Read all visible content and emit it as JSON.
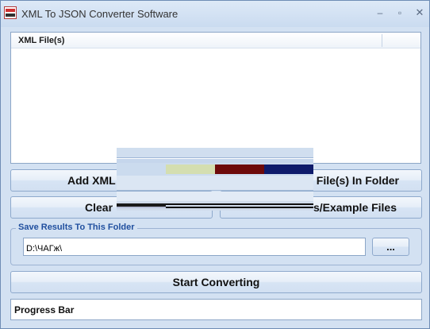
{
  "window": {
    "title": "XML To JSON Converter Software",
    "minimize": "–",
    "maximize": "▫",
    "close": "✕"
  },
  "file_list": {
    "header": "XML File(s)",
    "items": []
  },
  "buttons": {
    "add_files": "Add XML",
    "add_folder": "File(s) In Folder",
    "clear": "Clear",
    "example_files": "s/Example Files",
    "browse": "...",
    "start": "Start Converting"
  },
  "output": {
    "group_title": "Save Results To This Folder",
    "folder_path": "D:\\ЧАГж\\"
  },
  "progress": {
    "label": "Progress Bar"
  },
  "colors": {
    "accent": "#1f4e9e",
    "window_bg": "#d3e1f2",
    "glitch_red": "#6d0a0a",
    "glitch_blue": "#0e1b6b",
    "glitch_green": "#d4deb0"
  }
}
